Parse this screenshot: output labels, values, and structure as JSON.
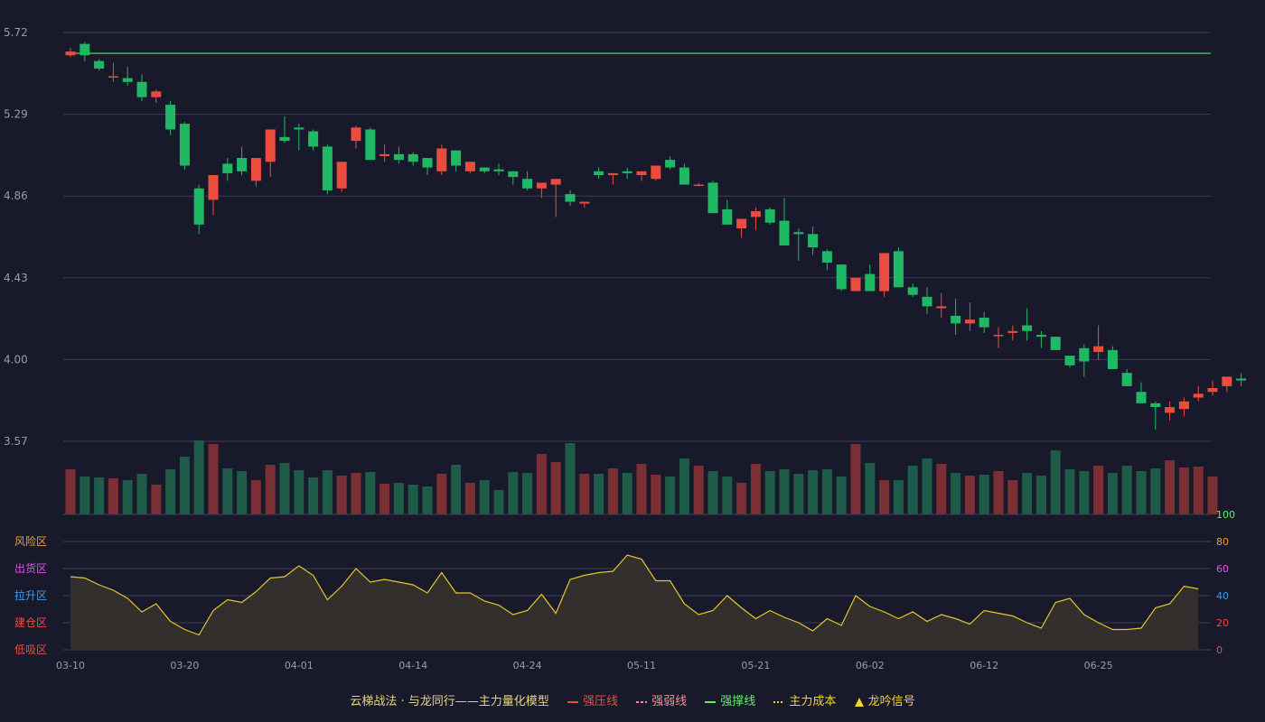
{
  "legend": {
    "title": "云梯战法 · 与龙同行——主力量化模型",
    "items": [
      {
        "label": "强压线",
        "color": "#ef4b3f",
        "style": "solid"
      },
      {
        "label": "强弱线",
        "color": "#ff8c8c",
        "style": "dashed"
      },
      {
        "label": "强撑线",
        "color": "#5cf05c",
        "style": "solid"
      },
      {
        "label": "主力成本",
        "color": "#f2d52f",
        "style": "dotted"
      },
      {
        "label": "龙吟信号",
        "color": "#f2d52f",
        "style": "triangle"
      }
    ]
  },
  "colors": {
    "background": "#181a2c",
    "up": "#ec4c3f",
    "down": "#1fb965",
    "vol_up": "#7a2f34",
    "vol_down": "#1e5b48",
    "grid": "#3a3d52",
    "axis_text": "#9a9cab",
    "resistance_line": "#3dbb4a",
    "oscillator_line": "#e6c52c",
    "oscillator_fill": "#332f2c"
  },
  "chart_data": [
    {
      "type": "candlestick",
      "y_ticks": [
        "5.72",
        "5.29",
        "4.86",
        "4.43",
        "4.00",
        "3.57"
      ],
      "ylim": [
        3.57,
        5.72
      ],
      "x_ticks": [
        {
          "index": 0,
          "label": "03-10"
        },
        {
          "index": 8,
          "label": "03-20"
        },
        {
          "index": 16,
          "label": "04-01"
        },
        {
          "index": 24,
          "label": "04-14"
        },
        {
          "index": 32,
          "label": "04-24"
        },
        {
          "index": 40,
          "label": "05-11"
        },
        {
          "index": 48,
          "label": "05-21"
        },
        {
          "index": 56,
          "label": "06-02"
        },
        {
          "index": 64,
          "label": "06-12"
        },
        {
          "index": 72,
          "label": "06-25"
        }
      ],
      "horizontal_line": 5.61,
      "ohlc": [
        [
          5.6,
          5.64,
          5.59,
          5.62
        ],
        [
          5.66,
          5.67,
          5.57,
          5.6
        ],
        [
          5.57,
          5.58,
          5.52,
          5.53
        ],
        [
          5.49,
          5.56,
          5.46,
          5.49
        ],
        [
          5.48,
          5.54,
          5.44,
          5.46
        ],
        [
          5.46,
          5.5,
          5.36,
          5.38
        ],
        [
          5.38,
          5.42,
          5.35,
          5.41
        ],
        [
          5.34,
          5.36,
          5.18,
          5.21
        ],
        [
          5.24,
          5.25,
          5.0,
          5.02
        ],
        [
          4.9,
          4.92,
          4.66,
          4.71
        ],
        [
          4.84,
          4.94,
          4.76,
          4.97
        ],
        [
          5.03,
          5.06,
          4.94,
          4.98
        ],
        [
          5.06,
          5.12,
          4.97,
          4.99
        ],
        [
          4.94,
          5.06,
          4.91,
          5.06
        ],
        [
          5.04,
          5.19,
          4.96,
          5.21
        ],
        [
          5.17,
          5.28,
          5.14,
          5.15
        ],
        [
          5.22,
          5.24,
          5.1,
          5.21
        ],
        [
          5.2,
          5.21,
          5.1,
          5.12
        ],
        [
          5.12,
          5.13,
          4.87,
          4.89
        ],
        [
          4.9,
          5.04,
          4.88,
          5.04
        ],
        [
          5.15,
          5.23,
          5.11,
          5.22
        ],
        [
          5.21,
          5.22,
          5.05,
          5.05
        ],
        [
          5.07,
          5.13,
          5.04,
          5.08
        ],
        [
          5.08,
          5.12,
          5.03,
          5.05
        ],
        [
          5.08,
          5.09,
          5.02,
          5.04
        ],
        [
          5.06,
          5.05,
          4.97,
          5.01
        ],
        [
          4.99,
          5.13,
          4.97,
          5.11
        ],
        [
          5.1,
          5.08,
          4.99,
          5.02
        ],
        [
          4.99,
          5.03,
          4.98,
          5.04
        ],
        [
          5.01,
          5.01,
          4.98,
          4.99
        ],
        [
          5.0,
          5.03,
          4.97,
          4.99
        ],
        [
          4.99,
          4.97,
          4.92,
          4.96
        ],
        [
          4.95,
          4.99,
          4.89,
          4.9
        ],
        [
          4.9,
          4.92,
          4.85,
          4.93
        ],
        [
          4.92,
          4.95,
          4.75,
          4.95
        ],
        [
          4.87,
          4.89,
          4.81,
          4.83
        ],
        [
          4.82,
          4.82,
          4.8,
          4.83
        ],
        [
          4.99,
          5.01,
          4.95,
          4.97
        ],
        [
          4.97,
          4.98,
          4.92,
          4.98
        ],
        [
          4.99,
          5.01,
          4.95,
          4.98
        ],
        [
          4.97,
          4.98,
          4.94,
          4.99
        ],
        [
          4.95,
          5.0,
          4.94,
          5.02
        ],
        [
          5.05,
          5.07,
          5.0,
          5.01
        ],
        [
          5.01,
          5.03,
          4.93,
          4.92
        ],
        [
          4.92,
          4.93,
          4.91,
          4.92
        ],
        [
          4.93,
          4.94,
          4.78,
          4.77
        ],
        [
          4.79,
          4.84,
          4.73,
          4.71
        ],
        [
          4.69,
          4.72,
          4.64,
          4.74
        ],
        [
          4.75,
          4.8,
          4.68,
          4.78
        ],
        [
          4.79,
          4.8,
          4.71,
          4.72
        ],
        [
          4.73,
          4.85,
          4.65,
          4.6
        ],
        [
          4.67,
          4.69,
          4.52,
          4.66
        ],
        [
          4.66,
          4.7,
          4.55,
          4.59
        ],
        [
          4.57,
          4.58,
          4.47,
          4.51
        ],
        [
          4.5,
          4.47,
          4.36,
          4.37
        ],
        [
          4.36,
          4.41,
          4.38,
          4.43
        ],
        [
          4.45,
          4.5,
          4.37,
          4.36
        ],
        [
          4.36,
          4.55,
          4.33,
          4.56
        ],
        [
          4.57,
          4.59,
          4.41,
          4.38
        ],
        [
          4.38,
          4.4,
          4.33,
          4.34
        ],
        [
          4.33,
          4.38,
          4.24,
          4.28
        ],
        [
          4.27,
          4.35,
          4.22,
          4.28
        ],
        [
          4.23,
          4.32,
          4.13,
          4.19
        ],
        [
          4.19,
          4.3,
          4.15,
          4.21
        ],
        [
          4.22,
          4.25,
          4.14,
          4.17
        ],
        [
          4.13,
          4.17,
          4.06,
          4.13
        ],
        [
          4.14,
          4.18,
          4.1,
          4.15
        ],
        [
          4.18,
          4.27,
          4.1,
          4.15
        ],
        [
          4.13,
          4.15,
          4.06,
          4.12
        ],
        [
          4.12,
          4.11,
          4.06,
          4.05
        ],
        [
          4.02,
          4.02,
          3.96,
          3.97
        ],
        [
          4.06,
          4.08,
          3.91,
          3.99
        ],
        [
          4.04,
          4.18,
          4.0,
          4.07
        ],
        [
          4.05,
          4.07,
          3.98,
          3.95
        ],
        [
          3.93,
          3.95,
          3.89,
          3.86
        ],
        [
          3.83,
          3.88,
          3.8,
          3.77
        ],
        [
          3.77,
          3.78,
          3.63,
          3.75
        ],
        [
          3.72,
          3.78,
          3.68,
          3.75
        ],
        [
          3.74,
          3.8,
          3.7,
          3.78
        ],
        [
          3.8,
          3.86,
          3.78,
          3.82
        ],
        [
          3.83,
          3.89,
          3.81,
          3.85
        ],
        [
          3.86,
          3.89,
          3.83,
          3.91
        ],
        [
          3.9,
          3.93,
          3.86,
          3.89
        ]
      ]
    },
    {
      "type": "bar",
      "series_name": "volume",
      "values": [
        50,
        42,
        41,
        40,
        38,
        45,
        33,
        50,
        64,
        82,
        78,
        51,
        48,
        38,
        55,
        57,
        49,
        41,
        49,
        43,
        46,
        47,
        34,
        35,
        33,
        31,
        45,
        55,
        35,
        38,
        27,
        47,
        46,
        67,
        58,
        79,
        45,
        45,
        51,
        46,
        56,
        44,
        42,
        62,
        54,
        48,
        42,
        35,
        56,
        48,
        50,
        45,
        49,
        50,
        42,
        78,
        57,
        38,
        38,
        54,
        62,
        56,
        46,
        43,
        44,
        48,
        38,
        46,
        43,
        71,
        50,
        48,
        54,
        46,
        54,
        48,
        51,
        60,
        52,
        53,
        42
      ]
    },
    {
      "type": "area",
      "series_name": "oscillator",
      "y_ticks": [
        "100",
        "80",
        "60",
        "40",
        "20",
        "0"
      ],
      "ylim": [
        0,
        100
      ],
      "zone_labels": [
        {
          "label": "风险区",
          "color": "#f0a030"
        },
        {
          "label": "出货区",
          "color": "#e44fe4"
        },
        {
          "label": "拉升区",
          "color": "#3c9cf0"
        },
        {
          "label": "建仓区",
          "color": "#ef4b3f"
        },
        {
          "label": "低吸区",
          "color": "#ef4b3f"
        }
      ],
      "values": [
        54,
        53,
        48,
        44,
        38,
        28,
        34,
        21,
        15,
        11,
        29,
        37,
        35,
        43,
        53,
        54,
        62,
        55,
        37,
        47,
        60,
        50,
        52,
        50,
        48,
        42,
        57,
        42,
        42,
        36,
        33,
        26,
        29,
        41,
        27,
        52,
        55,
        57,
        58,
        70,
        67,
        51,
        51,
        34,
        26,
        29,
        40,
        31,
        23,
        29,
        24,
        20,
        14,
        23,
        18,
        40,
        32,
        28,
        23,
        28,
        21,
        26,
        23,
        19,
        29,
        27,
        25,
        20,
        16,
        35,
        38,
        26,
        20,
        15,
        15,
        16,
        31,
        34,
        47,
        45
      ]
    }
  ]
}
